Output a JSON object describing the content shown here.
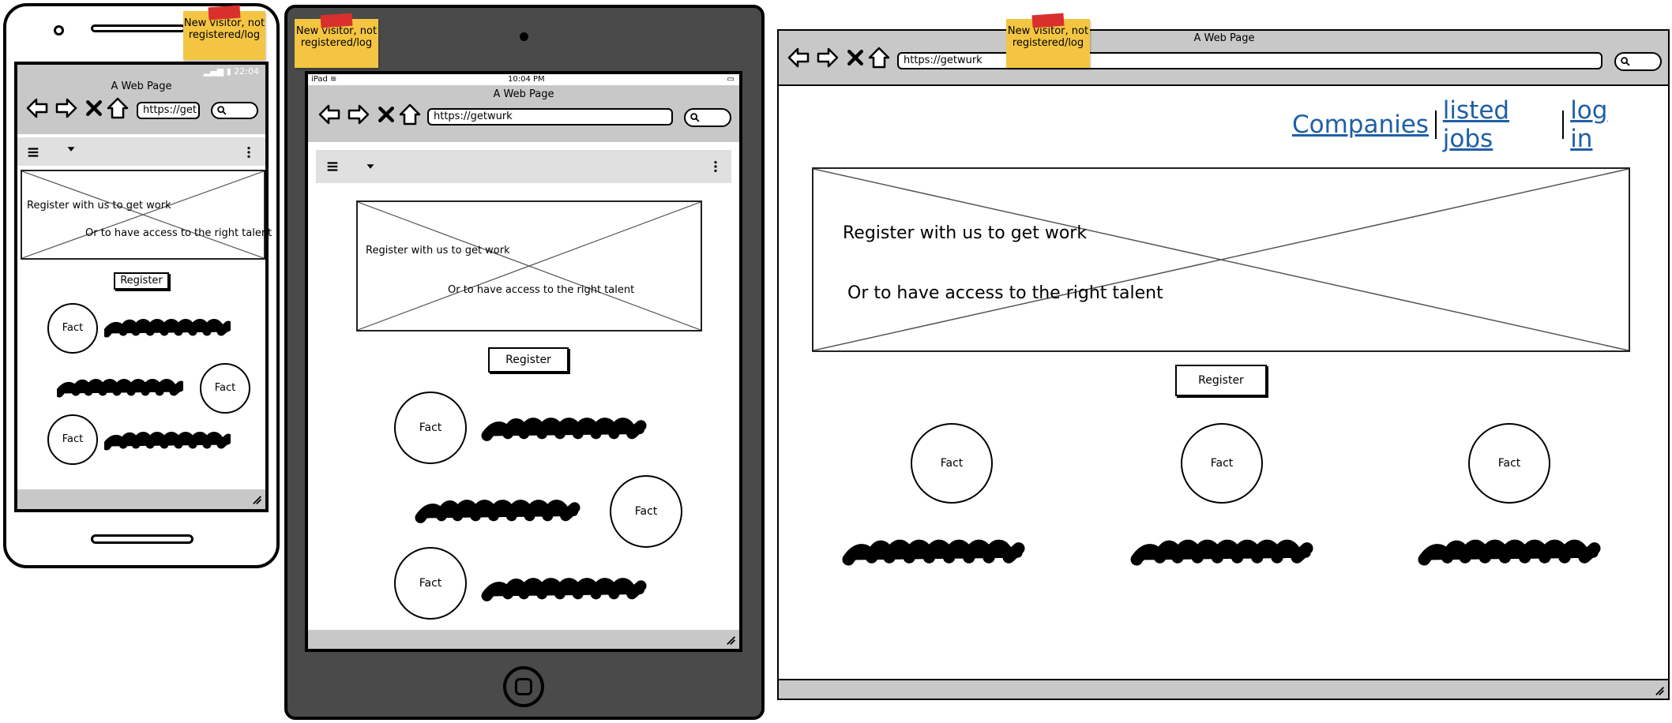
{
  "sticky_note": {
    "text": "New visitor, not registered/log"
  },
  "phone": {
    "status_time": "22:04",
    "page_title": "A Web Page",
    "url": "https://get",
    "hero_line1": "Register with us to get work",
    "hero_line2": "Or to have access to the right talent",
    "register_label": "Register",
    "fact_labels": [
      "Fact",
      "Fact",
      "Fact"
    ]
  },
  "tablet": {
    "status_device": "iPad",
    "status_time": "10:04 PM",
    "page_title": "A Web Page",
    "url": "https://getwurk",
    "hero_line1": "Register with us to get work",
    "hero_line2": "Or to have access to the right talent",
    "register_label": "Register",
    "fact_labels": [
      "Fact",
      "Fact",
      "Fact"
    ]
  },
  "desktop": {
    "page_title": "A Web Page",
    "url": "https://getwurk",
    "nav_links": [
      "Companies",
      "listed jobs",
      "log in"
    ],
    "hero_line1": "Register with us to get work",
    "hero_line2": "Or to have access to the right talent",
    "register_label": "Register",
    "fact_labels": [
      "Fact",
      "Fact",
      "Fact"
    ]
  },
  "icons": [
    "back-arrow-icon",
    "forward-arrow-icon",
    "close-icon",
    "home-icon",
    "search-icon",
    "hamburger-menu-icon",
    "dropdown-caret-icon",
    "kebab-menu-icon",
    "wifi-icon",
    "signal-icon",
    "battery-icon",
    "resize-grip-icon",
    "camera-icon",
    "home-button-icon"
  ],
  "colors": {
    "sticky": "#f4c542",
    "tape": "#d9302e",
    "tablet_body": "#4a4a4a",
    "chrome_gray": "#c8c8c8",
    "link": "#1f5fa6"
  }
}
